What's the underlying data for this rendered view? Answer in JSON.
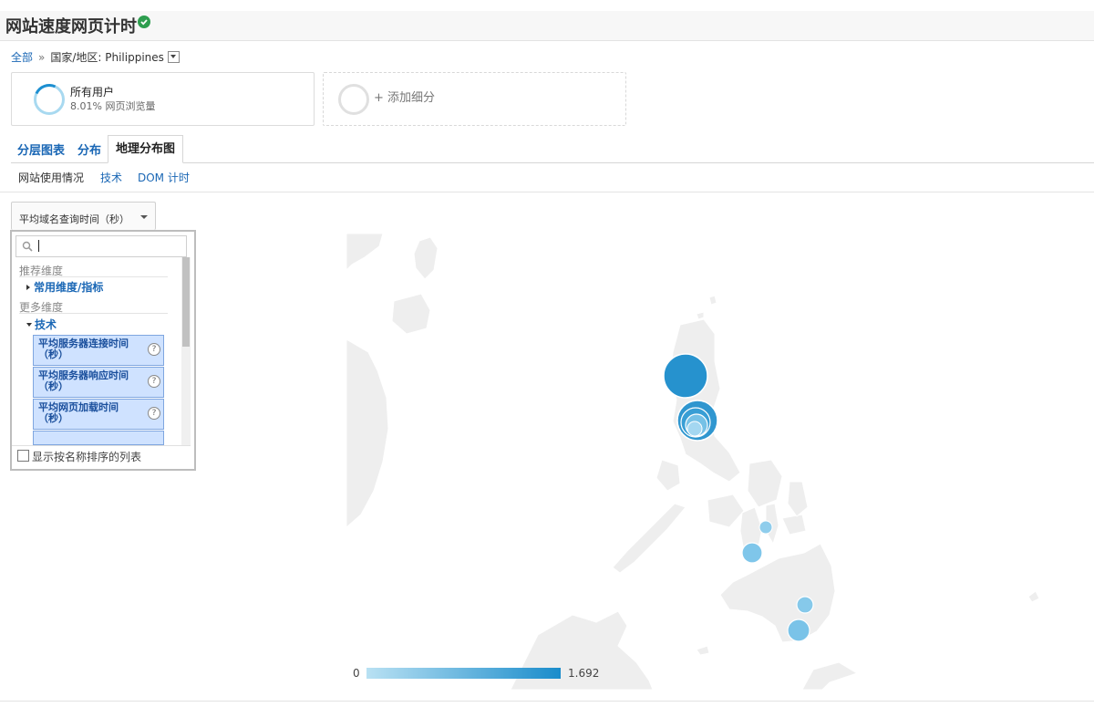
{
  "header": {
    "title": "网站速度网页计时"
  },
  "breadcrumb": {
    "root": "全部",
    "separator": "»",
    "filter": "国家/地区: Philippines"
  },
  "segments": [
    {
      "name": "所有用户",
      "sub": "8.01% 网页浏览量"
    },
    {
      "add_label": "+ 添加细分"
    }
  ],
  "tabs": [
    "分层图表",
    "分布",
    "地理分布图"
  ],
  "subnav": [
    "网站使用情况",
    "技术",
    "DOM 计时"
  ],
  "metric_select": {
    "value": "平均域名查询时间（秒）"
  },
  "picker": {
    "search_placeholder": "",
    "group_recommended": "推荐维度",
    "common_item": "常用维度/指标",
    "group_more": "更多维度",
    "tech_item": "技术",
    "metrics": [
      "平均服务器连接时间（秒）",
      "平均服务器响应时间（秒）",
      "平均网页加载时间（秒）"
    ],
    "footer_label": "显示按名称排序的列表"
  },
  "map": {
    "legend_min": "0",
    "legend_max": "1.692",
    "colors": {
      "low": "#b9e1f3",
      "high": "#1a8ccb",
      "land": "#eeeeee"
    }
  }
}
